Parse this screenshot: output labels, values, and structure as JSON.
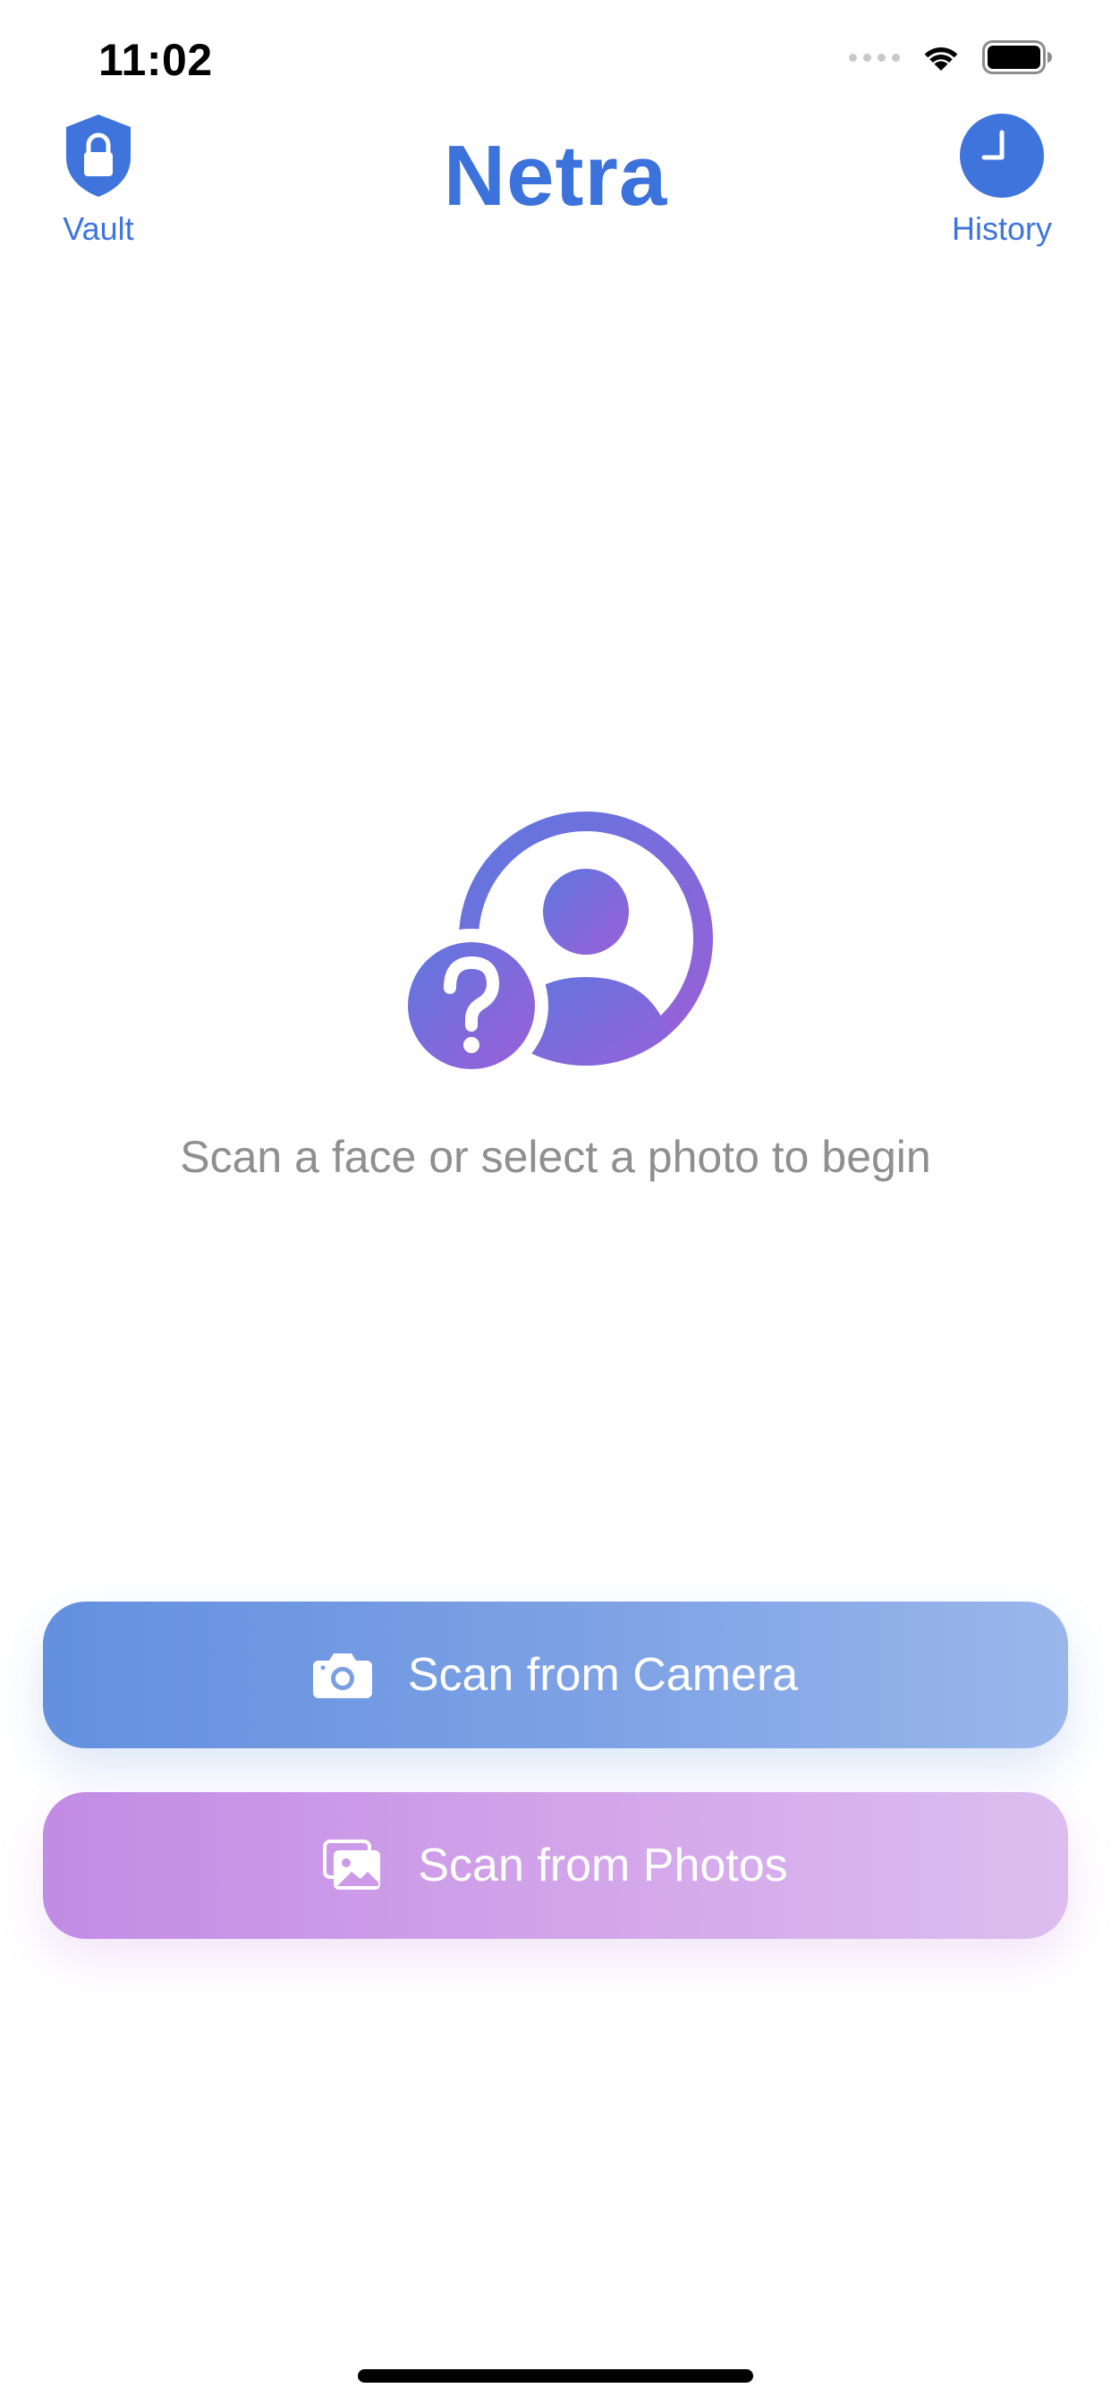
{
  "status_bar": {
    "time": "11:02"
  },
  "nav": {
    "title": "Netra",
    "left_item": {
      "label": "Vault",
      "icon": "shield-lock-icon"
    },
    "right_item": {
      "label": "History",
      "icon": "clock-icon"
    }
  },
  "hero": {
    "icon": "person-question-icon",
    "prompt": "Scan a face or select a photo to begin"
  },
  "actions": {
    "camera": {
      "label": "Scan from Camera",
      "icon": "camera-icon"
    },
    "photos": {
      "label": "Scan from Photos",
      "icon": "photos-icon"
    }
  },
  "colors": {
    "accent": "#3c72db",
    "camera_gradient_start": "#6390df",
    "camera_gradient_end": "#9ab7ec",
    "photos_gradient_start": "#c28be5",
    "photos_gradient_end": "#ddbdef",
    "prompt_text": "#8e8e93"
  }
}
